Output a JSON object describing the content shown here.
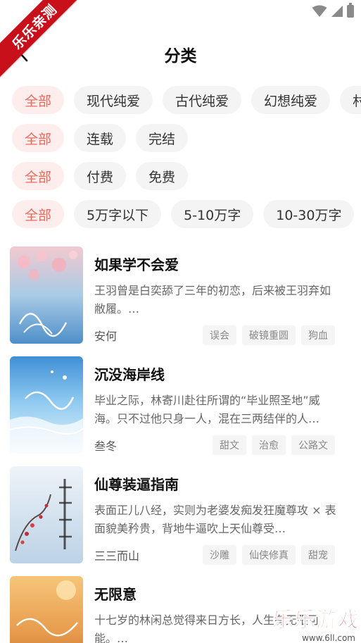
{
  "watermark_corner": "乐乐亲测",
  "watermark_bottom": {
    "text": "乐乐游戏",
    "url": "www.6ll.com"
  },
  "header": {
    "title": "分类"
  },
  "filters": {
    "category": [
      "全部",
      "现代纯爱",
      "古代纯爱",
      "幻想纯爱",
      "村"
    ],
    "status": [
      "全部",
      "连载",
      "完结"
    ],
    "price": [
      "全部",
      "付费",
      "免费"
    ],
    "wordcount": [
      "全部",
      "5万字以下",
      "5-10万字",
      "10-30万字"
    ]
  },
  "books": [
    {
      "title": "如果学不会爱",
      "desc": "王羽曾是白奕舔了三年的初恋，后来被王羽弃如敝履。…",
      "author": "安何",
      "tags": [
        "误会",
        "破镜重圆",
        "狗血"
      ]
    },
    {
      "title": "沉没海岸线",
      "desc": "毕业之际，林寄川赴往所谓的“毕业照圣地”威海。只不过他只身一人，混在三两结伴的人…",
      "author": "叁冬",
      "tags": [
        "甜文",
        "治愈",
        "公路文"
      ]
    },
    {
      "title": "仙尊装逼指南",
      "desc": "表面正儿八经，实则为老婆发痴发狂魔尊攻 × 表面貌美矜贵，背地牛逼吹上天仙尊受…",
      "author": "三三而山",
      "tags": [
        "沙雕",
        "仙侠修真",
        "甜宠"
      ]
    },
    {
      "title": "无限意",
      "desc": "十七岁的林闲总觉得来日方长，人生有无限可能。…",
      "author": "",
      "tags": []
    }
  ],
  "colors": {
    "accent": "#ec6a5c",
    "accent_bg": "#fdeeed",
    "chip_bg": "#f4f4f4"
  }
}
